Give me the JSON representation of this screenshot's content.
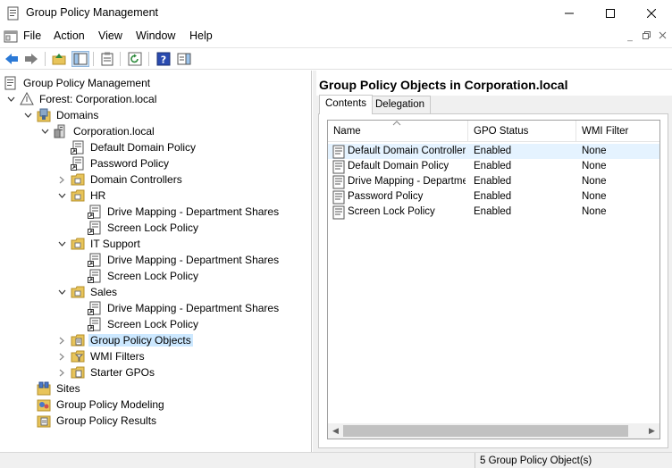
{
  "window": {
    "title": "Group Policy Management"
  },
  "menu": [
    "File",
    "Action",
    "View",
    "Window",
    "Help"
  ],
  "tree": {
    "root": "Group Policy Management",
    "forest": "Forest: Corporation.local",
    "domains": "Domains",
    "domain": "Corporation.local",
    "default_domain_policy": "Default Domain Policy",
    "password_policy": "Password Policy",
    "domain_controllers": "Domain Controllers",
    "hr": "HR",
    "hr_drive": "Drive Mapping - Department Shares",
    "hr_screen": "Screen Lock Policy",
    "it": "IT Support",
    "it_drive": "Drive Mapping - Department Shares",
    "it_screen": "Screen Lock Policy",
    "sales": "Sales",
    "sales_drive": "Drive Mapping - Department Shares",
    "sales_screen": "Screen Lock Policy",
    "gpo": "Group Policy Objects",
    "wmi": "WMI Filters",
    "starter": "Starter GPOs",
    "sites": "Sites",
    "modeling": "Group Policy Modeling",
    "results": "Group Policy Results"
  },
  "details": {
    "title": "Group Policy Objects in Corporation.local",
    "tabs": [
      "Contents",
      "Delegation"
    ],
    "columns": [
      "Name",
      "GPO Status",
      "WMI Filter"
    ],
    "rows": [
      {
        "name": "Default Domain Controller...",
        "status": "Enabled",
        "wmi": "None"
      },
      {
        "name": "Default Domain Policy",
        "status": "Enabled",
        "wmi": "None"
      },
      {
        "name": "Drive Mapping - Departme...",
        "status": "Enabled",
        "wmi": "None"
      },
      {
        "name": "Password Policy",
        "status": "Enabled",
        "wmi": "None"
      },
      {
        "name": "Screen Lock Policy",
        "status": "Enabled",
        "wmi": "None"
      }
    ]
  },
  "status": {
    "text": "5 Group Policy Object(s)"
  }
}
